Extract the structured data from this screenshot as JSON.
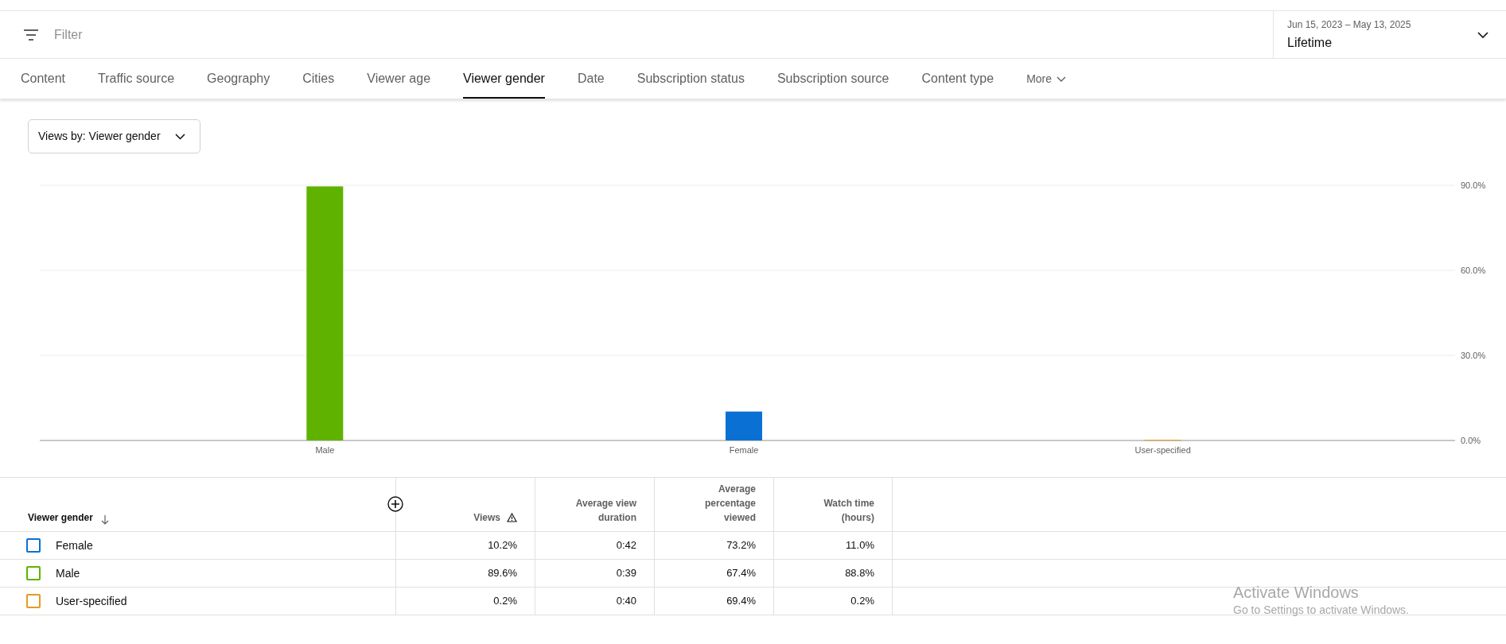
{
  "filter_bar": {
    "placeholder": "Filter"
  },
  "date_range": {
    "range": "Jun 15, 2023 – May 13, 2025",
    "period": "Lifetime"
  },
  "tabs": [
    {
      "label": "Content",
      "selected": false
    },
    {
      "label": "Traffic source",
      "selected": false
    },
    {
      "label": "Geography",
      "selected": false
    },
    {
      "label": "Cities",
      "selected": false
    },
    {
      "label": "Viewer age",
      "selected": false
    },
    {
      "label": "Viewer gender",
      "selected": true
    },
    {
      "label": "Date",
      "selected": false
    },
    {
      "label": "Subscription status",
      "selected": false
    },
    {
      "label": "Subscription source",
      "selected": false
    },
    {
      "label": "Content type",
      "selected": false
    }
  ],
  "more_tab": {
    "label": "More"
  },
  "metric_dropdown": {
    "value": "Views by: Viewer gender"
  },
  "chart_data": {
    "type": "bar",
    "categories": [
      "Male",
      "Female",
      "User-specified"
    ],
    "series": [
      {
        "color": "#5fb300",
        "values": [
          89.6,
          null,
          null
        ]
      },
      {
        "color": "#0b70d4",
        "values": [
          null,
          10.2,
          null
        ]
      },
      {
        "color": "#e59a21",
        "values": [
          null,
          null,
          0.2
        ]
      }
    ],
    "ylim": [
      0,
      90
    ],
    "yticks": [
      {
        "value": 0,
        "label": "0.0%"
      },
      {
        "value": 30,
        "label": "30.0%"
      },
      {
        "value": 60,
        "label": "60.0%"
      },
      {
        "value": 90,
        "label": "90.0%"
      }
    ]
  },
  "table": {
    "columns": [
      {
        "label": "Viewer gender"
      },
      {
        "label": "Views"
      },
      {
        "label": "Average view duration"
      },
      {
        "label": "Average percentage viewed"
      },
      {
        "label": "Watch time (hours)"
      }
    ],
    "rows": [
      {
        "checked": false,
        "color": "#0b70d4",
        "cells": [
          "Female",
          "10.2%",
          "0:42",
          "73.2%",
          "11.0%"
        ]
      },
      {
        "checked": false,
        "color": "#5fb300",
        "cells": [
          "Male",
          "89.6%",
          "0:39",
          "67.4%",
          "88.8%"
        ]
      },
      {
        "checked": false,
        "color": "#e59a21",
        "cells": [
          "User-specified",
          "0.2%",
          "0:40",
          "69.4%",
          "0.2%"
        ]
      }
    ]
  },
  "os_notice": {
    "title": "Activate Windows",
    "message": "Go to Settings to activate Windows."
  }
}
